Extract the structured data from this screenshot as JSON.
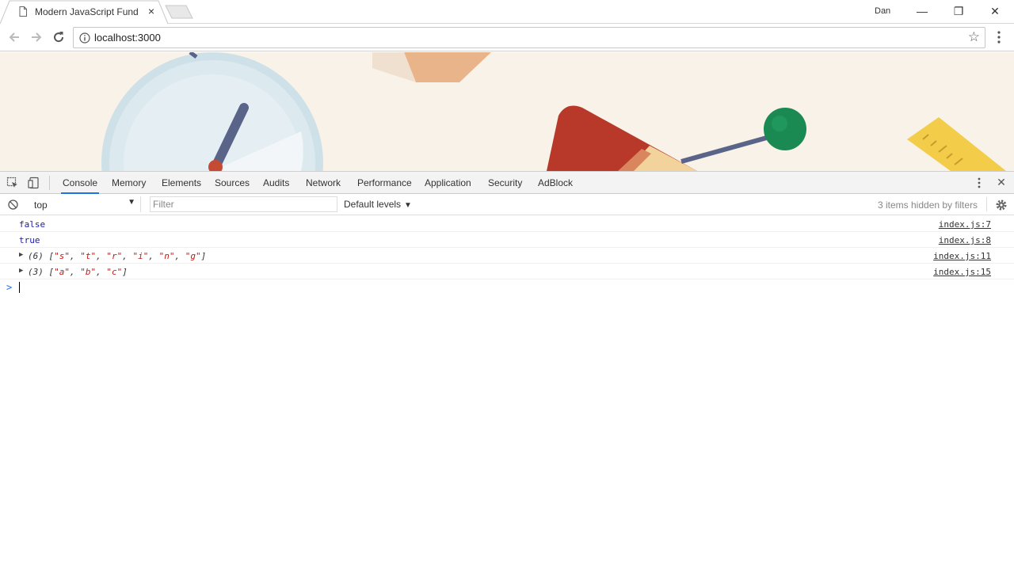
{
  "browser": {
    "tab_title": "Modern JavaScript Fund",
    "tab_close": "×",
    "profile": "Dan",
    "window_controls": {
      "minimize": "—",
      "restore": "❐",
      "close": "✕"
    },
    "url": "localhost:3000"
  },
  "devtools": {
    "tabs": [
      "Console",
      "Memory",
      "Elements",
      "Sources",
      "Audits",
      "Network",
      "Performance",
      "Application",
      "Security",
      "AdBlock"
    ],
    "active_tab": "Console",
    "close": "✕",
    "context": "top",
    "filter_placeholder": "Filter",
    "levels": "Default levels",
    "hidden_count": "3 items hidden by filters",
    "messages": [
      {
        "text": "false",
        "source": "index.js:7"
      },
      {
        "text": "true",
        "source": "index.js:8"
      },
      {
        "count": "(6)",
        "items": [
          "\"s\"",
          "\"t\"",
          "\"r\"",
          "\"i\"",
          "\"n\"",
          "\"g\""
        ],
        "source": "index.js:11"
      },
      {
        "count": "(3)",
        "items": [
          "\"a\"",
          "\"b\"",
          "\"c\""
        ],
        "source": "index.js:15"
      }
    ],
    "prompt_caret": ">"
  },
  "colors": {
    "accent": "#1a73e8",
    "boolean": "#1a1aa6",
    "string": "#c41a16",
    "banner_bg": "#f8f2e8"
  }
}
